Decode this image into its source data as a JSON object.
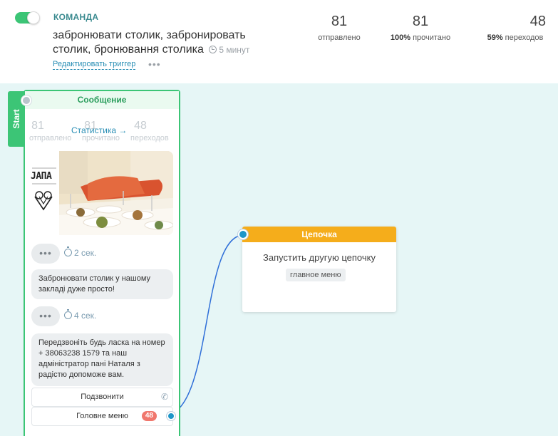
{
  "header": {
    "command_label": "КОМАНДА",
    "command_text": "забронювати столик, забронировать столик, бронювання столика",
    "duration": "5 минут",
    "edit_trigger": "Редактировать триггер",
    "more": "•••",
    "stats": [
      {
        "value": "81",
        "label_bold": "",
        "label": "отправлено"
      },
      {
        "value": "81",
        "label_bold": "100%",
        "label": " прочитано"
      },
      {
        "value": "48",
        "label_bold": "59%",
        "label": " переходов"
      }
    ]
  },
  "start_tab": "Start",
  "message": {
    "title": "Сообщение",
    "stats": [
      {
        "value": "81",
        "label": "отправлено"
      },
      {
        "value": "81",
        "label": "прочитано"
      },
      {
        "value": "48",
        "label": "переходов"
      }
    ],
    "stats_link": "Статистика →",
    "logo_text": "ЈАПА",
    "delays": [
      "2 сек.",
      "4 сек."
    ],
    "delay_dots": "•••",
    "bubbles": [
      "Забронювати столик у нашому закладі дуже просто!",
      "Передзвоніть будь ласка на номер  + 38063238 1579 та наш адміністратор пані Наталя з радістю допоможе вам."
    ],
    "buttons": [
      {
        "label": "Подзвонити",
        "icon": "phone-icon"
      },
      {
        "label": "Головне меню",
        "badge": "48"
      }
    ]
  },
  "chain": {
    "title": "Цепочка",
    "action": "Запустить другую цепочку",
    "tag": "главное меню"
  },
  "colors": {
    "green": "#3cc576",
    "orange": "#f5ad1b",
    "blue": "#1e96c8",
    "canvas": "#e6f6f6",
    "badge": "#f0776d"
  }
}
